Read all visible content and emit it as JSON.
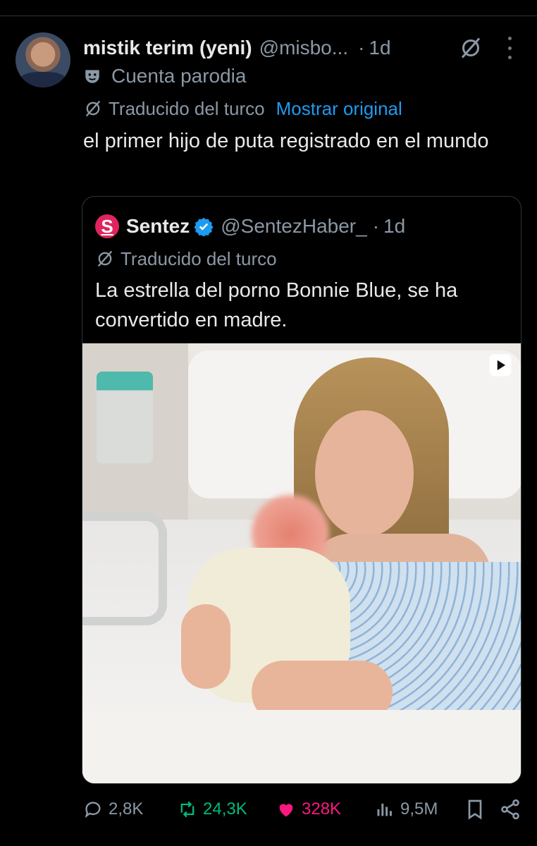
{
  "post": {
    "author_name": "mistik terim (yeni)",
    "handle": "@misbo...",
    "dot": "·",
    "time": "1d",
    "account_label": "Cuenta parodia",
    "translated_label": "Traducido del turco",
    "show_original": "Mostrar original",
    "text": "el primer hijo de puta registrado en el mundo"
  },
  "quote": {
    "logo_letter": "S",
    "name": "Sentez",
    "handle": "@SentezHaber_",
    "dot": "·",
    "time": "1d",
    "translated_label": "Traducido del turco",
    "text": "La estrella del porno Bonnie Blue, se ha convertido en madre."
  },
  "actions": {
    "replies": "2,8K",
    "reposts": "24,3K",
    "likes": "328K",
    "views": "9,5M"
  },
  "colors": {
    "background": "#000000",
    "text": "#e7e9ea",
    "muted": "#8b98a5",
    "link": "#1d9bf0",
    "repost": "#00ba7c",
    "like": "#f91880",
    "logo": "#e0245e"
  }
}
